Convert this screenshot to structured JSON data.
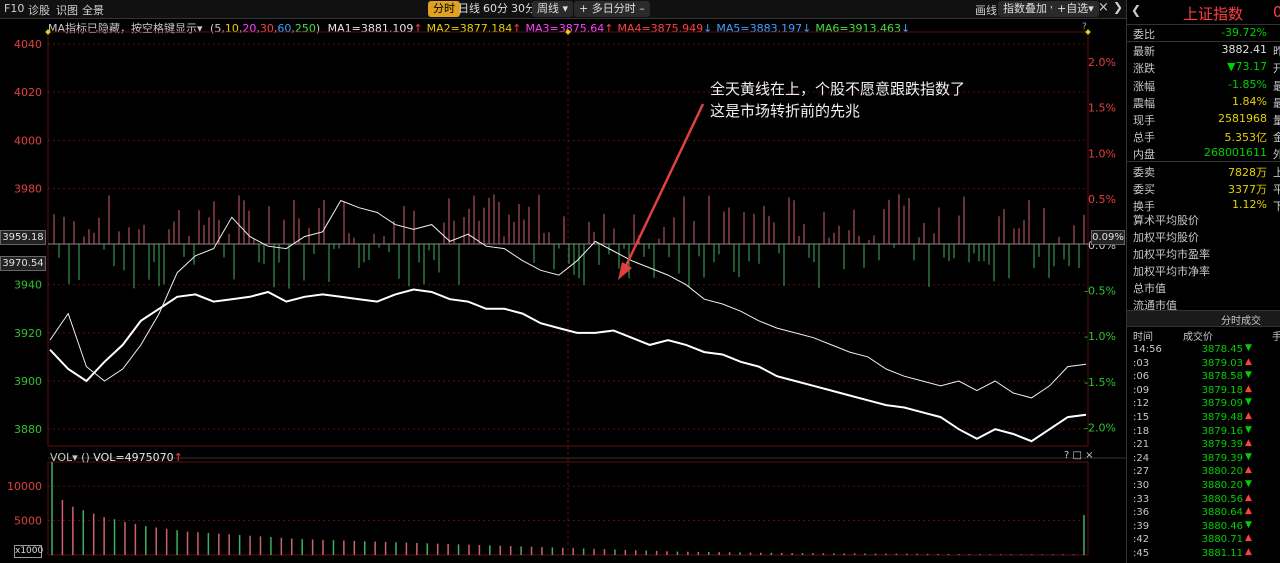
{
  "topbar": {
    "items": [
      "F10",
      "诊股",
      "识图",
      "全景"
    ],
    "tabs": [
      "分时",
      "日线",
      "60分",
      "30分",
      "周线",
      "多日分时"
    ],
    "active_tab": "分时",
    "right_items": [
      "画线",
      "指数叠加",
      "自选"
    ],
    "close_icon": "×"
  },
  "ma_bar": {
    "prefix": "MA",
    "hidden": "指标已隐藏",
    "hint": "按空格键显示",
    "params_open": "(5,",
    "params": [
      "10",
      "20",
      "30",
      "60",
      "250"
    ],
    "params_close": ")",
    "ma": [
      {
        "label": "MA1=3881.109",
        "arrow": "↑",
        "color": "#e6e6e6"
      },
      {
        "label": "MA2=3877.184",
        "arrow": "↑",
        "color": "#e6d000"
      },
      {
        "label": "MA3=3875.64",
        "arrow": "↑",
        "color": "#ff40ff"
      },
      {
        "label": "MA4=3875.949",
        "arrow": "↓",
        "color": "#ff4040"
      },
      {
        "label": "MA5=3883.197",
        "arrow": "↓",
        "color": "#40a0ff"
      },
      {
        "label": "MA6=3913.463",
        "arrow": "↓",
        "color": "#40e040"
      }
    ]
  },
  "price_badges": {
    "upper": "3959.18",
    "lower": "3970.54",
    "pct": "0.09%"
  },
  "annotation": {
    "line1": "全天黄线在上，个股不愿意跟跌指数了",
    "line2": "这是市场转折前的先兆"
  },
  "vol_bar": {
    "label": "VOL",
    "paren": "()",
    "value": "VOL=4975070",
    "arrow": "↑"
  },
  "vol_unit": "x1000",
  "chart_data": {
    "type": "line",
    "price_axis": {
      "ticks": [
        4040,
        4020,
        4000,
        3980,
        3940,
        3920,
        3900,
        3880
      ],
      "range": [
        3873,
        4045
      ]
    },
    "pct_axis": {
      "ticks": [
        "2.0%",
        "1.5%",
        "1.0%",
        "0.5%",
        "0.0%",
        "-0.5%",
        "-1.0%",
        "-1.5%",
        "-2.0%"
      ]
    },
    "vol_axis": {
      "ticks": [
        "10000",
        "5000"
      ],
      "range": [
        0,
        13500
      ]
    },
    "series": [
      {
        "color": "#ffffff",
        "values": [
          3913,
          3905,
          3900,
          3908,
          3915,
          3925,
          3930,
          3935,
          3936,
          3933,
          3934,
          3935,
          3937,
          3933,
          3935,
          3936,
          3935,
          3934,
          3933,
          3936,
          3938,
          3937,
          3934,
          3933,
          3930,
          3930,
          3928,
          3924,
          3922,
          3920,
          3920,
          3921,
          3918,
          3915,
          3917,
          3915,
          3912,
          3911,
          3908,
          3906,
          3902,
          3900,
          3898,
          3896,
          3894,
          3892,
          3890,
          3889,
          3887,
          3885,
          3880,
          3876,
          3880,
          3878,
          3875,
          3880,
          3885,
          3886
        ]
      },
      {
        "color": "#f0f0f0",
        "values": [
          3917,
          3928,
          3906,
          3900,
          3905,
          3915,
          3928,
          3945,
          3952,
          3955,
          3968,
          3960,
          3956,
          3955,
          3960,
          3962,
          3975,
          3972,
          3970,
          3965,
          3963,
          3965,
          3958,
          3961,
          3956,
          3955,
          3950,
          3946,
          3944,
          3950,
          3958,
          3954,
          3950,
          3947,
          3944,
          3940,
          3934,
          3932,
          3929,
          3925,
          3922,
          3920,
          3918,
          3915,
          3912,
          3910,
          3905,
          3902,
          3900,
          3898,
          3900,
          3896,
          3900,
          3895,
          3893,
          3898,
          3906,
          3907
        ]
      }
    ],
    "bars": {
      "color_up": "#d06070",
      "color_down": "#40b060"
    },
    "volume": [
      13500,
      8000,
      7000,
      6500,
      6000,
      5500,
      5200,
      4800,
      4500,
      4200,
      4000,
      3800,
      3600,
      3400,
      3300,
      3200,
      3100,
      3000,
      2900,
      2800,
      2700,
      2600,
      2500,
      2400,
      2300,
      2250,
      2200,
      2150,
      2100,
      2050,
      2000,
      1950,
      1900,
      1850,
      1800,
      1750,
      1700,
      1650,
      1600,
      1550,
      1500,
      1450,
      1400,
      1350,
      1300,
      1250,
      1200,
      1150,
      1100,
      1050,
      1000,
      950,
      900,
      850,
      800,
      750,
      700,
      650,
      600,
      550,
      500,
      480,
      460,
      440,
      420,
      400,
      380,
      360,
      340,
      320,
      300,
      290,
      280,
      270,
      260,
      250,
      240,
      230,
      220,
      210,
      200,
      190,
      180,
      170,
      160,
      150,
      140,
      130,
      120,
      110,
      100,
      100,
      100,
      100,
      100,
      100,
      100,
      100,
      100,
      5800
    ]
  },
  "sidebar": {
    "title": "上证指数",
    "title_suffix": "0",
    "rows": [
      {
        "k": "委比",
        "v": "-39.72%",
        "c": "green",
        "x": ""
      },
      {
        "k": "最新",
        "v": "3882.41",
        "c": "",
        "x": "昨"
      },
      {
        "k": "涨跌",
        "v": "▼73.17",
        "c": "green",
        "x": "开"
      },
      {
        "k": "涨幅",
        "v": "-1.85%",
        "c": "green",
        "x": "最"
      },
      {
        "k": "震幅",
        "v": "1.84%",
        "c": "yel",
        "x": "最"
      },
      {
        "k": "现手",
        "v": "2581968",
        "c": "yel",
        "x": "量"
      },
      {
        "k": "总手",
        "v": "5.353亿",
        "c": "yel",
        "x": "金"
      },
      {
        "k": "内盘",
        "v": "268001611",
        "c": "green",
        "x": "外"
      },
      {
        "k": "委卖",
        "v": "7828万",
        "c": "yel",
        "x": "上"
      },
      {
        "k": "委买",
        "v": "3377万",
        "c": "yel",
        "x": "平"
      },
      {
        "k": "换手",
        "v": "1.12%",
        "c": "yel",
        "x": "下"
      }
    ],
    "links": [
      "算术平均股价",
      "加权平均股价",
      "加权平均市盈率",
      "加权平均市净率",
      "总市值",
      "流通市值"
    ],
    "tick_header": {
      "title": "分时成交",
      "col_time": "时间",
      "col_price": "成交价",
      "col_vol": "手"
    },
    "ticks": [
      {
        "t": "14:56",
        "p": "3878.45",
        "a": "▼",
        "c": "green"
      },
      {
        "t": ":03",
        "p": "3879.03",
        "a": "▲",
        "c": "green"
      },
      {
        "t": ":06",
        "p": "3878.58",
        "a": "▼",
        "c": "green"
      },
      {
        "t": ":09",
        "p": "3879.18",
        "a": "▲",
        "c": "green"
      },
      {
        "t": ":12",
        "p": "3879.09",
        "a": "▼",
        "c": "green"
      },
      {
        "t": ":15",
        "p": "3879.48",
        "a": "▲",
        "c": "green"
      },
      {
        "t": ":18",
        "p": "3879.16",
        "a": "▼",
        "c": "green"
      },
      {
        "t": ":21",
        "p": "3879.39",
        "a": "▲",
        "c": "green"
      },
      {
        "t": ":24",
        "p": "3879.39",
        "a": "▼",
        "c": "green"
      },
      {
        "t": ":27",
        "p": "3880.20",
        "a": "▲",
        "c": "green"
      },
      {
        "t": ":30",
        "p": "3880.20",
        "a": "▼",
        "c": "green"
      },
      {
        "t": ":33",
        "p": "3880.56",
        "a": "▲",
        "c": "green"
      },
      {
        "t": ":36",
        "p": "3880.64",
        "a": "▲",
        "c": "green"
      },
      {
        "t": ":39",
        "p": "3880.46",
        "a": "▼",
        "c": "green"
      },
      {
        "t": ":42",
        "p": "3880.71",
        "a": "▲",
        "c": "green"
      },
      {
        "t": ":45",
        "p": "3881.11",
        "a": "▲",
        "c": "green"
      }
    ]
  },
  "colors": {
    "grid": "#5a0f0f",
    "axis_red": "#e04040",
    "axis_green": "#30c030",
    "arrow": "#e04040",
    "annotation": "#f0f0f0"
  }
}
